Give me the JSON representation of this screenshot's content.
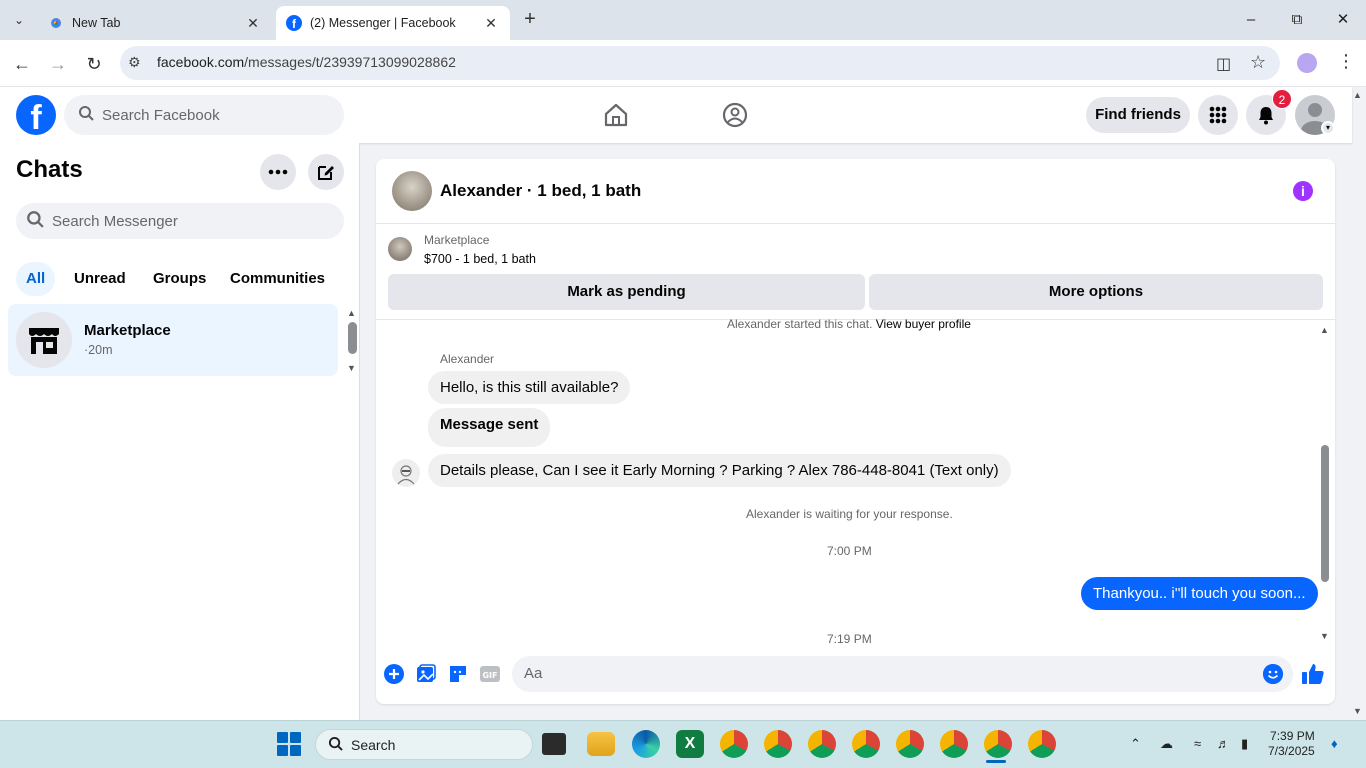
{
  "browser": {
    "tabs": [
      {
        "title": "New Tab",
        "active": false
      },
      {
        "title": "(2) Messenger | Facebook",
        "active": true
      }
    ],
    "url_domain": "facebook.com",
    "url_path": "/messages/t/23939713099028862"
  },
  "fb_header": {
    "search_placeholder": "Search Facebook",
    "find_friends_label": "Find friends",
    "notification_count": "2"
  },
  "sidebar": {
    "title": "Chats",
    "search_placeholder": "Search Messenger",
    "filters": [
      "All",
      "Unread",
      "Groups",
      "Communities"
    ],
    "active_filter": "All",
    "chats": [
      {
        "name": "Marketplace",
        "time": "·20m"
      }
    ]
  },
  "conversation": {
    "title": "Alexander · 1 bed, 1 bath",
    "marketplace_label": "Marketplace",
    "listing": "$700 - 1 bed, 1 bath",
    "mark_pending_label": "Mark as pending",
    "more_options_label": "More options",
    "started_text": "Alexander started this chat.",
    "view_profile_link": "View buyer profile",
    "sender_name": "Alexander",
    "messages": [
      {
        "from": "Alexander",
        "text": "Hello, is this still available?"
      },
      {
        "from": "Alexander",
        "text": "Message sent"
      },
      {
        "from": "Alexander",
        "text": "Details please, Can I see it Early Morning ? Parking ? Alex 786-448-8041 (Text only)"
      },
      {
        "from": "me",
        "text": "Thankyou.. i''ll touch you soon..."
      }
    ],
    "waiting_text": "Alexander is waiting for your response.",
    "timestamp_1": "7:00 PM",
    "timestamp_2": "7:19 PM",
    "composer_placeholder": "Aa"
  },
  "taskbar": {
    "search_placeholder": "Search",
    "time": "7:39 PM",
    "date": "7/3/2025"
  },
  "colors": {
    "fb_blue": "#0866ff",
    "badge_red": "#e41e3f",
    "info_purple": "#a033ff"
  }
}
